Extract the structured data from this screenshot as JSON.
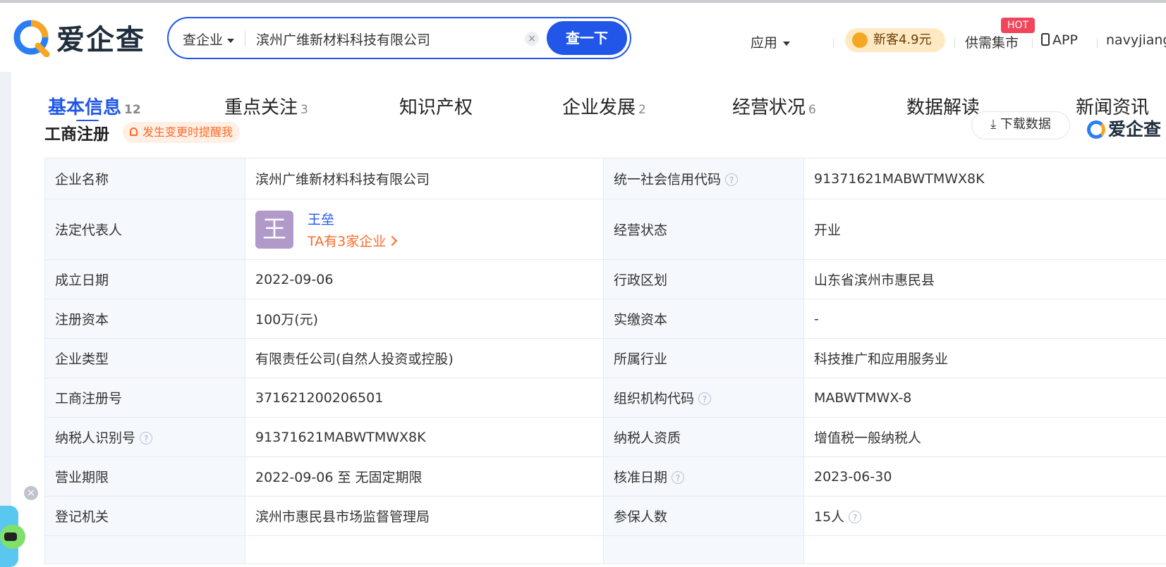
{
  "header": {
    "logo_text": "爱企查",
    "search": {
      "type_label": "查企业",
      "value": "滨州广维新材料科技有限公司",
      "clear_icon": "×",
      "button_label": "查一下"
    },
    "nav": {
      "apps_label": "应用",
      "vip_label": "新客4.9元",
      "supply_label": "供需集市",
      "hot_badge": "HOT",
      "app_label": "APP",
      "user_label": "navyjiang"
    }
  },
  "tabs": [
    {
      "label": "基本信息",
      "count": "12",
      "active": true
    },
    {
      "label": "重点关注",
      "count": "3"
    },
    {
      "label": "知识产权",
      "count": ""
    },
    {
      "label": "企业发展",
      "count": "2"
    },
    {
      "label": "经营状况",
      "count": "6"
    },
    {
      "label": "数据解读",
      "count": ""
    },
    {
      "label": "新闻资讯",
      "count": ""
    }
  ],
  "section": {
    "title": "工商注册",
    "remind_label": "发生变更时提醒我",
    "download_label": "下载数据",
    "watermark_logo": "爱企查"
  },
  "table": {
    "rows": [
      {
        "l1": "企业名称",
        "v1": "滨州广维新材料科技有限公司",
        "l2": "统一社会信用代码",
        "v2": "91371621MABWTMWX8K"
      },
      {
        "l1": "法定代表人",
        "v1": "王垒",
        "l2": "经营状态",
        "v2": "开业"
      },
      {
        "l1": "成立日期",
        "v1": "2022-09-06",
        "l2": "行政区划",
        "v2": "山东省滨州市惠民县"
      },
      {
        "l1": "注册资本",
        "v1": "100万(元)",
        "l2": "实缴资本",
        "v2": "-"
      },
      {
        "l1": "企业类型",
        "v1": "有限责任公司(自然人投资或控股)",
        "l2": "所属行业",
        "v2": "科技推广和应用服务业"
      },
      {
        "l1": "工商注册号",
        "v1": "371621200206501",
        "l2": "组织机构代码",
        "v2": "MABWTMWX-8"
      },
      {
        "l1": "纳税人识别号",
        "v1": "91371621MABWTMWX8K",
        "l2": "纳税人资质",
        "v2": "增值税一般纳税人"
      },
      {
        "l1": "营业期限",
        "v1": "2022-09-06 至 无固定期限",
        "l2": "核准日期",
        "v2": "2023-06-30"
      },
      {
        "l1": "登记机关",
        "v1": "滨州市惠民县市场监督管理局",
        "l2": "参保人数",
        "v2": "15人"
      }
    ],
    "legal_rep": {
      "avatar_char": "王",
      "name": "王垒",
      "companies_link": "TA有3家企业"
    },
    "help_icon": "?"
  },
  "colors": {
    "primary": "#2156e8",
    "accent_orange": "#ff6a26",
    "label_bg": "#f5f8fd"
  }
}
